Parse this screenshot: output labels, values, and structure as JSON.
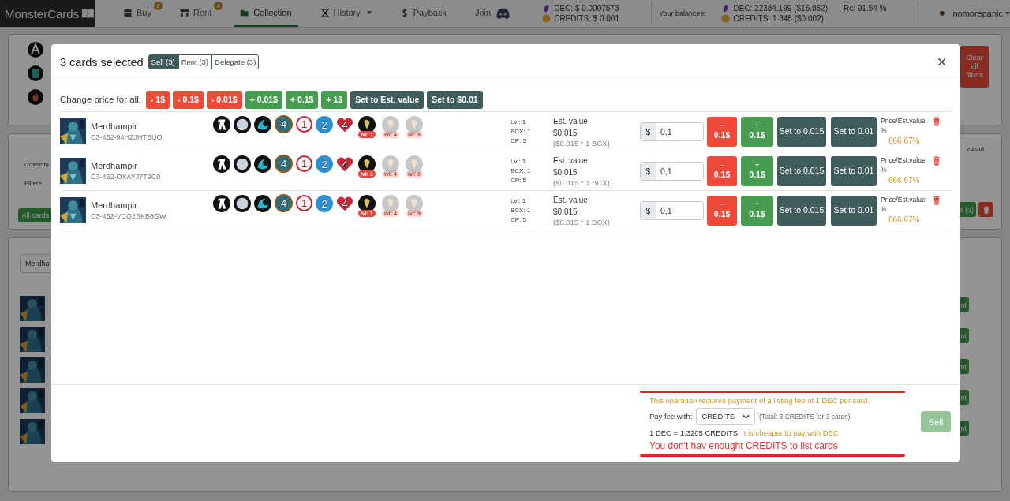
{
  "navbar": {
    "brand": "MonsterCards",
    "items": [
      {
        "label": "Buy",
        "badge": "2",
        "dropdown": false,
        "selected": false
      },
      {
        "label": "Rent",
        "badge": "4",
        "dropdown": false,
        "selected": false
      },
      {
        "label": "Collection",
        "dropdown": false,
        "selected": true
      },
      {
        "label": "History",
        "dropdown": true,
        "selected": false
      },
      {
        "label": "Payback",
        "dropdown": false,
        "selected": false
      }
    ],
    "join": "Join",
    "prices": [
      {
        "kind": "dec",
        "text": "DEC: $ 0.0007573"
      },
      {
        "kind": "credits",
        "text": "CREDITS: $ 0.001"
      }
    ],
    "balances_label": "Your balances:",
    "balances": [
      {
        "kind": "dec",
        "text": "DEC: 22384.199 ($16.952)"
      },
      {
        "kind": "credits",
        "text": "CREDITS: 1.848 ($0.002)"
      }
    ],
    "rc": "Rc: 91.54 %",
    "user": "nomorepanic"
  },
  "filters_panel": {
    "clear_button": "Clear all filters"
  },
  "summary_panel": {
    "rows": [
      "Collectio",
      "Filtere"
    ],
    "all_cards_button": "All cards",
    "column_fragment": "ed out",
    "selected_button": "s (3)"
  },
  "list_panel": {
    "search_value": "Merdha",
    "rows": [
      {
        "button": "nt"
      },
      {
        "button": "nt"
      },
      {
        "button": "nt"
      },
      {
        "button": "nt"
      },
      {
        "button": "nt"
      }
    ]
  },
  "modal": {
    "title": "3 cards selected",
    "close": "×",
    "tabs": [
      {
        "label": "Sell (3)",
        "selected": true
      },
      {
        "label": "Rent (3)",
        "selected": false
      },
      {
        "label": "Delegate (3)",
        "selected": false
      }
    ],
    "price_all": {
      "label": "Change price for all:",
      "buttons": [
        {
          "kind": "minus",
          "label": "- 1$"
        },
        {
          "kind": "minus",
          "label": "- 0.1$"
        },
        {
          "kind": "minus",
          "label": "- 0.01$"
        },
        {
          "kind": "plus",
          "label": "+ 0.01$"
        },
        {
          "kind": "plus",
          "label": "+ 0.1$"
        },
        {
          "kind": "plus",
          "label": "+ 1$"
        },
        {
          "kind": "set",
          "label": "Set to Est. value"
        },
        {
          "kind": "set",
          "label": "Set to $0.01"
        }
      ]
    },
    "cards": [
      {
        "name": "Merdhampir",
        "id": "C3-452-94HZJHTSUO",
        "stats": [
          {
            "kind": "mana",
            "value": "4"
          },
          {
            "kind": "ranged",
            "value": "1"
          },
          {
            "kind": "speed",
            "value": "2"
          },
          {
            "kind": "health",
            "value": "4"
          }
        ],
        "abilities": [
          {
            "label": "lvl: 1",
            "unlocked": true
          },
          {
            "label": "lvl: 4",
            "unlocked": false
          },
          {
            "label": "lvl: 9",
            "unlocked": false
          }
        ],
        "info": [
          "Lvl: 1",
          "BCX: 1",
          "CP: 5"
        ],
        "est_label": "Est. value",
        "est": "$0.015",
        "est_formula": "($0.015 * 1 BCX)",
        "currency": "$",
        "price": "0,1",
        "minus": [
          "-",
          "0.1$"
        ],
        "plus": [
          "+",
          "0.1$"
        ],
        "set_est": "Set to 0.015",
        "set_min": "Set to 0.01",
        "ratio_label": "Price/Est.value %",
        "ratio": "666.67%"
      },
      {
        "name": "Merdhampir",
        "id": "C3-452-OXAYJ7T9C0",
        "stats": [
          {
            "kind": "mana",
            "value": "4"
          },
          {
            "kind": "ranged",
            "value": "1"
          },
          {
            "kind": "speed",
            "value": "2"
          },
          {
            "kind": "health",
            "value": "4"
          }
        ],
        "abilities": [
          {
            "label": "lvl: 1",
            "unlocked": true
          },
          {
            "label": "lvl: 4",
            "unlocked": false
          },
          {
            "label": "lvl: 9",
            "unlocked": false
          }
        ],
        "info": [
          "Lvl: 1",
          "BCX: 1",
          "CP: 5"
        ],
        "est_label": "Est. value",
        "est": "$0.015",
        "est_formula": "($0.015 * 1 BCX)",
        "currency": "$",
        "price": "0,1",
        "minus": [
          "-",
          "0.1$"
        ],
        "plus": [
          "+",
          "0.1$"
        ],
        "set_est": "Set to 0.015",
        "set_min": "Set to 0.01",
        "ratio_label": "Price/Est.value %",
        "ratio": "666.67%"
      },
      {
        "name": "Merdhampir",
        "id": "C3-452-VCO2SKB8GW",
        "stats": [
          {
            "kind": "mana",
            "value": "4"
          },
          {
            "kind": "ranged",
            "value": "1"
          },
          {
            "kind": "speed",
            "value": "2"
          },
          {
            "kind": "health",
            "value": "4"
          }
        ],
        "abilities": [
          {
            "label": "lvl: 1",
            "unlocked": true
          },
          {
            "label": "lvl: 4",
            "unlocked": false
          },
          {
            "label": "lvl: 9",
            "unlocked": false
          }
        ],
        "info": [
          "Lvl: 1",
          "BCX: 1",
          "CP: 5"
        ],
        "est_label": "Est. value",
        "est": "$0.015",
        "est_formula": "($0.015 * 1 BCX)",
        "currency": "$",
        "price": "0,1",
        "minus": [
          "-",
          "0.1$"
        ],
        "plus": [
          "+",
          "0.1$"
        ],
        "set_est": "Set to 0.015",
        "set_min": "Set to 0.01",
        "ratio_label": "Price/Est.value %",
        "ratio": "666.67%"
      }
    ],
    "footer": {
      "fee_notice": "This operation requires payment of a listing fee of 1 DEC per card.",
      "pay_label": "Pay fee with:",
      "pay_select": "CREDITS",
      "total": "(Total: 3 CREDITS for 3 cards)",
      "rate": "1 DEC = 1.3205 CREDITS",
      "hint": "It is cheaper to pay with DEC",
      "error": "You don't hav enought CREDITS to list cards",
      "sell_button": {
        "label": "Sell",
        "disabled": true
      }
    }
  }
}
